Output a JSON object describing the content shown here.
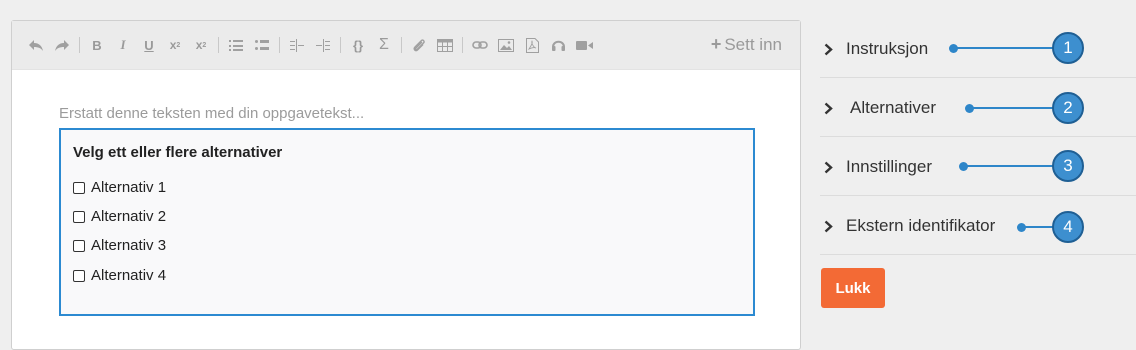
{
  "toolbar": {
    "insert_label": "Sett inn"
  },
  "editor": {
    "placeholder": "Erstatt denne teksten med din oppgavetekst...",
    "question": {
      "title": "Velg ett eller flere alternativer",
      "options": [
        "Alternativ 1",
        "Alternativ 2",
        "Alternativ 3",
        "Alternativ 4"
      ]
    }
  },
  "panel": {
    "items": [
      {
        "label": "Instruksjon",
        "badge": "1"
      },
      {
        "label": "Alternativer",
        "badge": "2"
      },
      {
        "label": "Innstillinger",
        "badge": "3"
      },
      {
        "label": "Ekstern identifikator",
        "badge": "4"
      }
    ],
    "close_label": "Lukk"
  },
  "colors": {
    "accent": "#2c8ad1",
    "button": "#f36a35",
    "badge": "#3d8fcf"
  }
}
